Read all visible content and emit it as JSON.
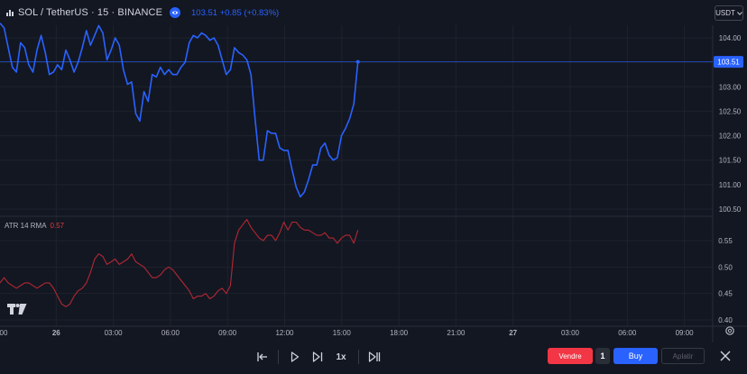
{
  "header": {
    "symbol": "SOL / TetherUS · 15 · BINANCE",
    "price_info": "103.51 +0.85 (+0.83%)",
    "currency": "USDT"
  },
  "colors": {
    "price_line": "#2962ff",
    "atr_line": "#b22833",
    "buy": "#2962ff",
    "sell": "#f23645",
    "background": "#131722"
  },
  "chart_data": [
    {
      "type": "line",
      "series": [
        {
          "values": [
            104.3,
            104.2,
            103.8,
            103.4,
            103.3,
            103.9,
            103.8,
            103.45,
            103.3,
            103.75,
            104.05,
            103.7,
            103.25,
            103.3,
            103.45,
            103.35,
            103.75,
            103.55,
            103.3,
            103.5,
            103.8,
            104.15,
            103.85,
            104.05,
            104.25,
            104.1,
            103.55,
            103.75,
            104.0,
            103.85,
            103.35,
            103.05,
            103.1,
            102.45,
            102.3,
            102.9,
            102.7,
            103.25,
            103.2,
            103.4,
            103.25,
            103.35,
            103.25,
            103.25,
            103.4,
            103.5,
            103.9,
            104.05,
            104.0,
            104.1,
            104.05,
            103.95,
            104.0,
            103.85,
            103.55,
            103.25,
            103.35,
            103.8,
            103.7,
            103.65,
            103.55,
            103.25,
            102.35,
            101.5,
            101.5,
            102.1,
            102.05,
            102.05,
            101.75,
            101.7,
            101.7,
            101.3,
            100.95,
            100.75,
            100.85,
            101.1,
            101.4,
            101.4,
            101.75,
            101.85,
            101.6,
            101.5,
            101.55,
            102.0,
            102.15,
            102.35,
            102.65,
            103.51
          ]
        }
      ],
      "ylim": [
        100.35,
        104.3
      ],
      "y_ticks": [
        "104.00",
        "103.50",
        "103.00",
        "102.50",
        "102.00",
        "101.50",
        "101.00",
        "100.50"
      ],
      "last_price_label": "103.51"
    },
    {
      "type": "line",
      "title": "ATR 14 RMA",
      "last_value": "0.57",
      "series": [
        {
          "values": [
            0.47,
            0.48,
            0.47,
            0.465,
            0.46,
            0.465,
            0.47,
            0.47,
            0.465,
            0.46,
            0.465,
            0.47,
            0.47,
            0.46,
            0.445,
            0.43,
            0.425,
            0.43,
            0.445,
            0.455,
            0.46,
            0.47,
            0.49,
            0.515,
            0.525,
            0.52,
            0.505,
            0.51,
            0.515,
            0.505,
            0.51,
            0.515,
            0.525,
            0.51,
            0.505,
            0.5,
            0.49,
            0.48,
            0.48,
            0.485,
            0.495,
            0.5,
            0.495,
            0.485,
            0.475,
            0.465,
            0.455,
            0.44,
            0.445,
            0.445,
            0.45,
            0.44,
            0.445,
            0.455,
            0.46,
            0.45,
            0.465,
            0.545,
            0.57,
            0.58,
            0.59,
            0.575,
            0.565,
            0.555,
            0.55,
            0.56,
            0.56,
            0.55,
            0.565,
            0.585,
            0.57,
            0.585,
            0.585,
            0.575,
            0.57,
            0.57,
            0.565,
            0.56,
            0.56,
            0.565,
            0.555,
            0.555,
            0.545,
            0.555,
            0.56,
            0.56,
            0.545,
            0.57
          ]
        }
      ],
      "ylim": [
        0.4,
        0.6
      ],
      "y_ticks": [
        "0.55",
        "0.50",
        "0.45",
        "0.40"
      ]
    }
  ],
  "x_axis": {
    "labels": [
      "00",
      "26",
      "03:00",
      "06:00",
      "09:00",
      "12:00",
      "15:00",
      "18:00",
      "21:00",
      "27",
      "03:00",
      "06:00",
      "09:00"
    ]
  },
  "bottom_bar": {
    "speed": "1x",
    "sell_label": "Vendre",
    "quantity": "1",
    "buy_label": "Buy",
    "flatten_label": "Aplatir"
  },
  "icons": [
    "chart-type-icon",
    "eye-icon",
    "tradingview-logo-icon",
    "settings-gear-icon",
    "jump-to-start-icon",
    "play-icon",
    "step-forward-icon",
    "jump-to-realtime-icon",
    "close-icon",
    "chevron-down-icon"
  ]
}
